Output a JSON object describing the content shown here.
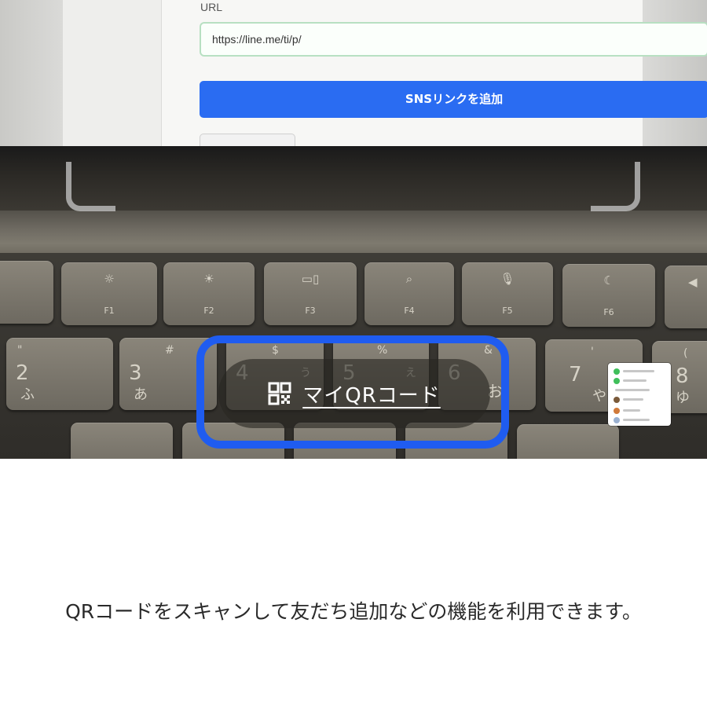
{
  "screen": {
    "url_label": "URL",
    "url_value": "https://line.me/ti/p/",
    "add_sns_button": "SNSリンクを追加"
  },
  "keys": {
    "f1": "F1",
    "f2": "F2",
    "f3": "F3",
    "f4": "F4",
    "f5": "F5",
    "f6": "F6",
    "k2": {
      "sym": "\"",
      "num": "2",
      "kana": "ふ"
    },
    "k3": {
      "sym": "#",
      "num": "3",
      "kana": "あ"
    },
    "k4": {
      "sym": "$",
      "num": "4",
      "kana": "う"
    },
    "k5": {
      "sym": "%",
      "num": "5",
      "kana": "え"
    },
    "k6": {
      "sym": "&",
      "num": "6",
      "kana": "お"
    },
    "k7": {
      "sym": "'",
      "num": "7",
      "kana": "や"
    },
    "k8": {
      "sym": "(",
      "num": "8",
      "kana": "ゆ"
    }
  },
  "my_qr": {
    "label": "マイQRコード",
    "icon": "qr-code-icon"
  },
  "description": "QRコードをスキャンして友だち追加などの機能を利用できます。",
  "colors": {
    "highlight": "#1f5cf0",
    "sns_button": "#2a6cf2"
  }
}
